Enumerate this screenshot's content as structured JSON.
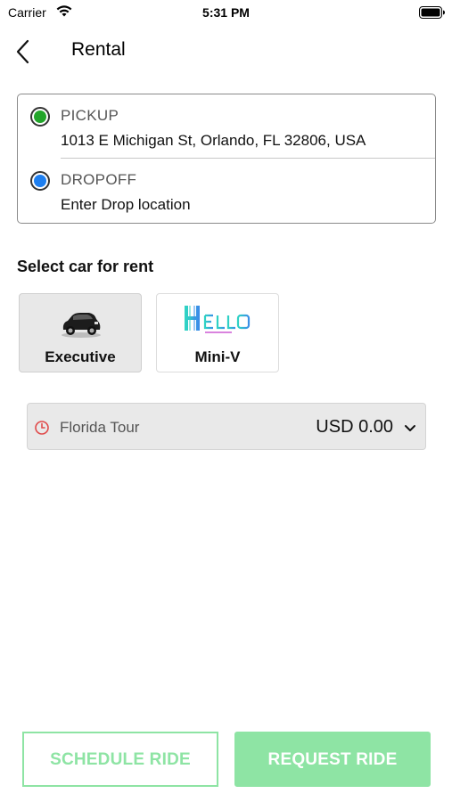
{
  "status_bar": {
    "carrier": "Carrier",
    "time": "5:31 PM",
    "wifi_icon": "wifi-icon",
    "battery_icon": "battery-icon"
  },
  "nav": {
    "back_icon": "chevron-left-icon",
    "title": "Rental"
  },
  "locations": {
    "pickup": {
      "label": "PICKUP",
      "value": "1013 E Michigan St, Orlando, FL 32806, USA",
      "dot_color": "#22a52a"
    },
    "dropoff": {
      "label": "DROPOFF",
      "placeholder": "Enter Drop location",
      "dot_color": "#1e7ff0"
    }
  },
  "car_section": {
    "title": "Select car for rent",
    "cars": [
      {
        "name": "Executive",
        "selected": true,
        "icon": "car-icon"
      },
      {
        "name": "Mini-V",
        "selected": false,
        "icon": "hello-logo"
      }
    ]
  },
  "fare": {
    "icon": "clock-icon",
    "package": "Florida Tour",
    "price": "USD 0.00",
    "dropdown_icon": "chevron-down-icon"
  },
  "actions": {
    "schedule_label": "SCHEDULE RIDE",
    "request_label": "REQUEST RIDE",
    "accent": "#8ee4a4"
  }
}
